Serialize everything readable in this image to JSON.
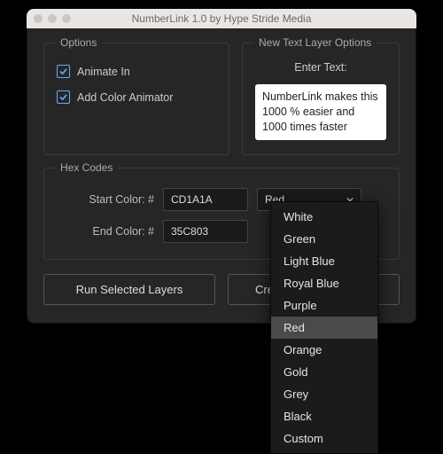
{
  "window": {
    "title": "NumberLink 1.0 by Hype Stride Media"
  },
  "options": {
    "legend": "Options",
    "animate_in": {
      "label": "Animate In",
      "checked": true
    },
    "add_color_animator": {
      "label": "Add Color Animator",
      "checked": true
    }
  },
  "new_text_layer": {
    "legend": "New Text Layer Options",
    "enter_label": "Enter Text:",
    "text_value": "NumberLink makes this\n1000 % easier and\n1000 times faster"
  },
  "hex": {
    "legend": "Hex Codes",
    "start_label": "Start Color: #",
    "start_value": "CD1A1A",
    "end_label": "End Color: #",
    "end_value": "35C803",
    "preset_selected": "Red"
  },
  "buttons": {
    "run": "Run Selected Layers",
    "create": "Create New Text Layer"
  },
  "dropdown": {
    "items": [
      "White",
      "Green",
      "Light Blue",
      "Royal Blue",
      "Purple",
      "Red",
      "Orange",
      "Gold",
      "Grey",
      "Black",
      "Custom"
    ],
    "highlighted": "Red"
  }
}
